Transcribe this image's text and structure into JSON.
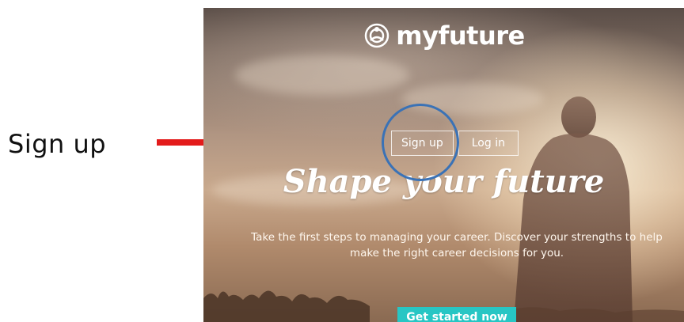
{
  "annotation": {
    "label": "Sign up"
  },
  "site": {
    "brand": "myfuture",
    "logo_icon": "myfuture-logo-icon",
    "auth": {
      "signup_label": "Sign up",
      "login_label": "Log in"
    },
    "headline": "Shape your future",
    "subtext_line1": "Take the first steps to managing your career. Discover your strengths to help",
    "subtext_line2": "make the right career decisions for you.",
    "cta_label": "Get started now",
    "colors": {
      "cta": "#27c6c4",
      "annotation_arrow": "#e31b1b",
      "annotation_circle": "#3a72b6"
    }
  }
}
